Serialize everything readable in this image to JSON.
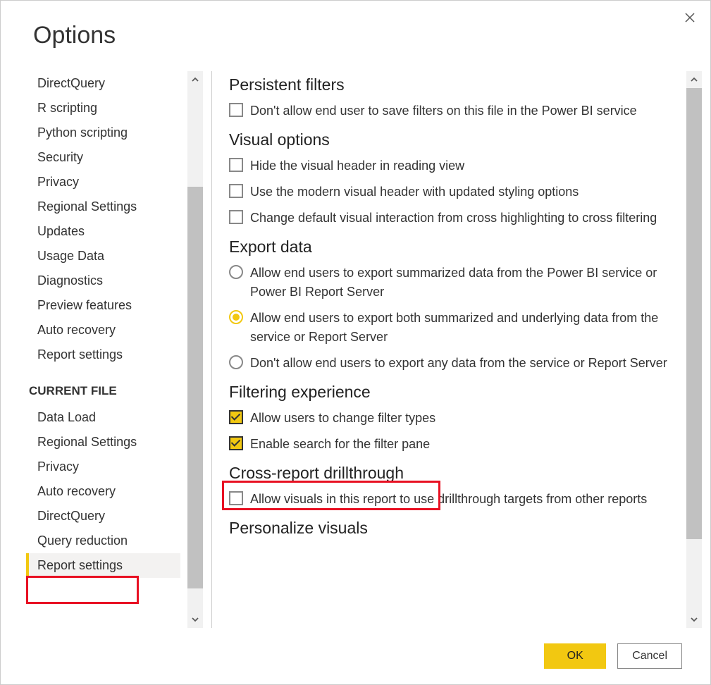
{
  "dialog": {
    "title": "Options",
    "ok_label": "OK",
    "cancel_label": "Cancel"
  },
  "sidebar": {
    "items_global": [
      "DirectQuery",
      "R scripting",
      "Python scripting",
      "Security",
      "Privacy",
      "Regional Settings",
      "Updates",
      "Usage Data",
      "Diagnostics",
      "Preview features",
      "Auto recovery",
      "Report settings"
    ],
    "current_file_header": "CURRENT FILE",
    "items_current": [
      "Data Load",
      "Regional Settings",
      "Privacy",
      "Auto recovery",
      "DirectQuery",
      "Query reduction",
      "Report settings"
    ],
    "selected_index_current": 6
  },
  "content": {
    "sections": {
      "persistent_filters": {
        "title": "Persistent filters",
        "opt1": "Don't allow end user to save filters on this file in the Power BI service"
      },
      "visual_options": {
        "title": "Visual options",
        "opt1": "Hide the visual header in reading view",
        "opt2": "Use the modern visual header with updated styling options",
        "opt3": "Change default visual interaction from cross highlighting to cross filtering"
      },
      "export_data": {
        "title": "Export data",
        "opt1": "Allow end users to export summarized data from the Power BI service or Power BI Report Server",
        "opt2": "Allow end users to export both summarized and underlying data from the service or Report Server",
        "opt3": "Don't allow end users to export any data from the service or Report Server",
        "selected": 1
      },
      "filtering_experience": {
        "title": "Filtering experience",
        "opt1": "Allow users to change filter types",
        "opt2": "Enable search for the filter pane"
      },
      "cross_report": {
        "title": "Cross-report drillthrough",
        "opt1": "Allow visuals in this report to use drillthrough targets from other reports"
      },
      "personalize": {
        "title": "Personalize visuals"
      }
    }
  }
}
